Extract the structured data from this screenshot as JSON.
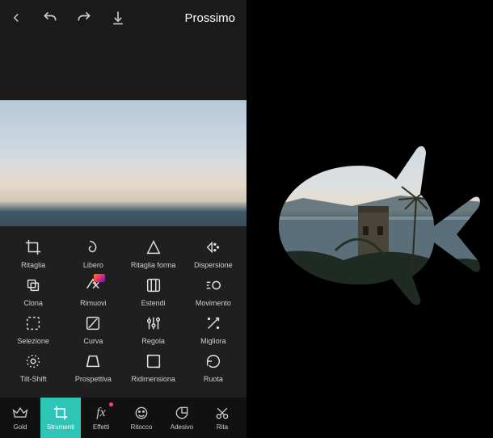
{
  "header": {
    "next_label": "Prossimo"
  },
  "tools": {
    "rows": [
      [
        {
          "id": "ritaglia",
          "label": "Ritaglia"
        },
        {
          "id": "libero",
          "label": "Libero"
        },
        {
          "id": "ritaglia-forma",
          "label": "Ritaglia forma"
        },
        {
          "id": "dispersione",
          "label": "Dispersione"
        }
      ],
      [
        {
          "id": "clona",
          "label": "Clona"
        },
        {
          "id": "rimuovi",
          "label": "Rimuovi",
          "badge": true
        },
        {
          "id": "estendi",
          "label": "Estendi"
        },
        {
          "id": "movimento",
          "label": "Movimento"
        }
      ],
      [
        {
          "id": "selezione",
          "label": "Selezione"
        },
        {
          "id": "curva",
          "label": "Curva"
        },
        {
          "id": "regola",
          "label": "Regola"
        },
        {
          "id": "migliora",
          "label": "Migliora"
        }
      ],
      [
        {
          "id": "tilt-shift",
          "label": "Tilt-Shift"
        },
        {
          "id": "prospettiva",
          "label": "Prospettiva"
        },
        {
          "id": "ridimensiona",
          "label": "Ridimensiona"
        },
        {
          "id": "ruota",
          "label": "Ruota"
        }
      ]
    ]
  },
  "bottom": {
    "items": [
      {
        "id": "gold",
        "label": "Gold"
      },
      {
        "id": "strumenti",
        "label": "Strumenti",
        "active": true
      },
      {
        "id": "effetti",
        "label": "Effetti",
        "dot": true
      },
      {
        "id": "ritocco",
        "label": "Ritocco"
      },
      {
        "id": "adesivo",
        "label": "Adesivo"
      },
      {
        "id": "rita",
        "label": "Rita"
      }
    ]
  },
  "colors": {
    "accent": "#2ec4b6",
    "bg_dark": "#1a1a1a"
  }
}
